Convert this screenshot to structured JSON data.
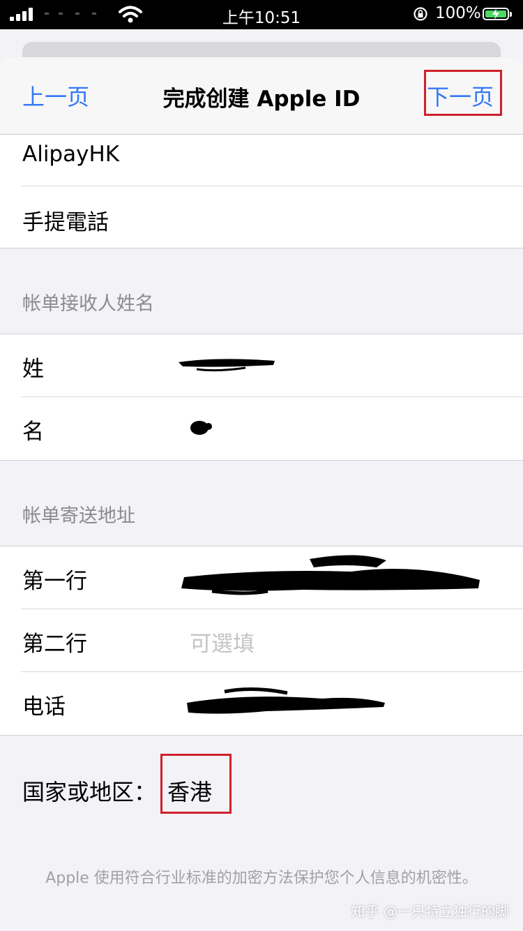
{
  "status_bar": {
    "time": "上午10:51",
    "battery_percent": "100%",
    "battery_color": "#4cd964"
  },
  "nav": {
    "back_label": "上一页",
    "title": "完成创建 Apple ID",
    "next_label": "下一页",
    "accent_color": "#3478f6"
  },
  "payment_options": [
    {
      "label": "AlipayHK"
    },
    {
      "label": "手提電話"
    }
  ],
  "billing_name": {
    "header": "帐单接收人姓名",
    "fields": [
      {
        "label": "姓",
        "value_redacted": true
      },
      {
        "label": "名",
        "value_redacted": true
      }
    ]
  },
  "billing_address": {
    "header": "帐单寄送地址",
    "fields": [
      {
        "label": "第一行",
        "value_redacted": true
      },
      {
        "label": "第二行",
        "placeholder": "可選填"
      },
      {
        "label": "电话",
        "value_redacted": true
      }
    ]
  },
  "country": {
    "label": "国家或地区：",
    "value": "香港"
  },
  "footer_note": "Apple 使用符合行业标准的加密方法保护您个人信息的机密性。",
  "watermark": "知乎 @一只特立独行的脚",
  "annotation_color": "#d11f2b"
}
